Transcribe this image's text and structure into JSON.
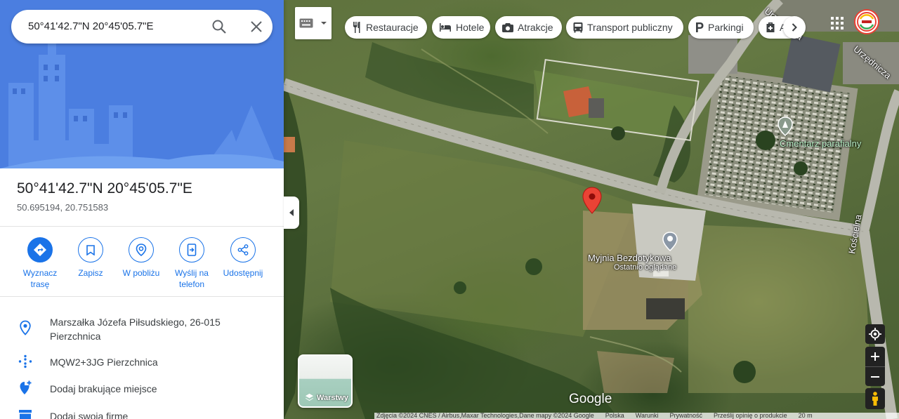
{
  "search": {
    "value": "50°41'42.7\"N 20°45'05.7\"E"
  },
  "place": {
    "title": "50°41'42.7\"N 20°45'05.7\"E",
    "decimal_coords": "50.695194, 20.751583"
  },
  "actions": [
    {
      "label": "Wyznacz trasę",
      "icon": "directions-icon"
    },
    {
      "label": "Zapisz",
      "icon": "bookmark-icon"
    },
    {
      "label": "W pobliżu",
      "icon": "nearby-icon"
    },
    {
      "label": "Wyślij na telefon",
      "icon": "send-to-phone-icon"
    },
    {
      "label": "Udostępnij",
      "icon": "share-icon"
    }
  ],
  "info": {
    "address_line1": "Marszałka Józefa Piłsudskiego, 26-015",
    "address_line2": "Pierzchnica",
    "plus_code": "MQW2+3JG Pierzchnica",
    "add_place": "Dodaj brakujące miejsce",
    "add_business": "Dodaj swoją firmę"
  },
  "chips": [
    {
      "label": "Restauracje",
      "icon": "restaurant-icon"
    },
    {
      "label": "Hotele",
      "icon": "hotel-icon"
    },
    {
      "label": "Atrakcje",
      "icon": "camera-icon"
    },
    {
      "label": "Transport publiczny",
      "icon": "transit-icon"
    },
    {
      "label": "Parkingi",
      "icon": "parking-icon"
    },
    {
      "label": "A",
      "icon": "pharmacy-icon"
    }
  ],
  "map_labels": {
    "cemetery": "Cmentarz parafialny",
    "carwash": "Myjnia Bezdotykowa",
    "recent": "Ostatnio oglądane",
    "street_kosc": "Kościelna",
    "street_urz1": "Urzędnicza",
    "street_urz2": "Urzędnicza"
  },
  "layers": {
    "label": "Warstwy"
  },
  "branding": {
    "google": "Google"
  },
  "attribution": {
    "imagery": "Zdjęcia ©2024 CNES / Airbus,Maxar Technologies,Dane mapy ©2024 Google",
    "country": "Polska",
    "terms": "Warunki",
    "privacy": "Prywatność",
    "feedback": "Prześlij opinię o produkcie",
    "scale": "20 m"
  },
  "colors": {
    "accent": "#1a73e8",
    "pin": "#ea4335",
    "hero": "#4a7de0"
  }
}
